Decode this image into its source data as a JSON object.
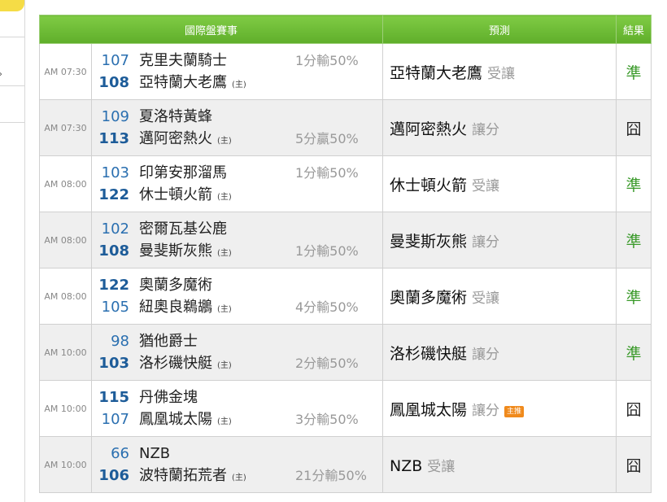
{
  "header": {
    "col_match": "國際盤賽事",
    "col_prediction": "預測",
    "col_result": "結果"
  },
  "home_marker": "(主)",
  "rows": [
    {
      "time": "AM 07:30",
      "n1": "107",
      "t1": "克里夫蘭騎士",
      "s1": "1分輸50%",
      "n2": "108",
      "t2": "亞特蘭大老鷹",
      "s2": "",
      "pred_team": "亞特蘭大老鷹",
      "pred_type": "受讓",
      "badge": "",
      "result": "準"
    },
    {
      "time": "AM 07:30",
      "n1": "109",
      "t1": "夏洛特黃蜂",
      "s1": "",
      "n2": "113",
      "t2": "邁阿密熱火",
      "s2": "5分贏50%",
      "pred_team": "邁阿密熱火",
      "pred_type": "讓分",
      "badge": "",
      "result": "囧"
    },
    {
      "time": "AM 08:00",
      "n1": "103",
      "t1": "印第安那溜馬",
      "s1": "1分輸50%",
      "n2": "122",
      "t2": "休士頓火箭",
      "s2": "",
      "pred_team": "休士頓火箭",
      "pred_type": "受讓",
      "badge": "",
      "result": "準"
    },
    {
      "time": "AM 08:00",
      "n1": "102",
      "t1": "密爾瓦基公鹿",
      "s1": "",
      "n2": "108",
      "t2": "曼斐斯灰熊",
      "s2": "1分輸50%",
      "pred_team": "曼斐斯灰熊",
      "pred_type": "讓分",
      "badge": "",
      "result": "準"
    },
    {
      "time": "AM 08:00",
      "n1": "122",
      "t1": "奧蘭多魔術",
      "s1": "",
      "n2": "105",
      "t2": "紐奧良鵜鶘",
      "s2": "4分輸50%",
      "pred_team": "奧蘭多魔術",
      "pred_type": "受讓",
      "badge": "",
      "result": "準"
    },
    {
      "time": "AM 10:00",
      "n1": "98",
      "t1": "猶他爵士",
      "s1": "",
      "n2": "103",
      "t2": "洛杉磯快艇",
      "s2": "2分輸50%",
      "pred_team": "洛杉磯快艇",
      "pred_type": "讓分",
      "badge": "",
      "result": "準"
    },
    {
      "time": "AM 10:00",
      "n1": "115",
      "t1": "丹佛金塊",
      "s1": "",
      "n2": "107",
      "t2": "鳳凰城太陽",
      "s2": "3分輸50%",
      "pred_team": "鳳凰城太陽",
      "pred_type": "讓分",
      "badge": "主推",
      "result": "囧"
    },
    {
      "time": "AM 10:00",
      "n1": "66",
      "t1": "NZB",
      "s1": "",
      "n2": "106",
      "t2": "波特蘭拓荒者",
      "s2": "21分輸50%",
      "pred_team": "NZB",
      "pred_type": "受讓",
      "badge": "",
      "result": "囧"
    }
  ],
  "bold_num": [
    [
      false,
      true
    ],
    [
      false,
      true
    ],
    [
      false,
      true
    ],
    [
      false,
      true
    ],
    [
      true,
      false
    ],
    [
      false,
      true
    ],
    [
      true,
      false
    ],
    [
      false,
      true
    ]
  ],
  "result_status": [
    "win",
    "loss",
    "win",
    "win",
    "win",
    "win",
    "loss",
    "loss"
  ],
  "colors": {
    "header_green": "#6cbb34",
    "win": "#3a9a2a",
    "number_blue": "#2a6fb0",
    "badge_orange": "#f08a1c"
  }
}
